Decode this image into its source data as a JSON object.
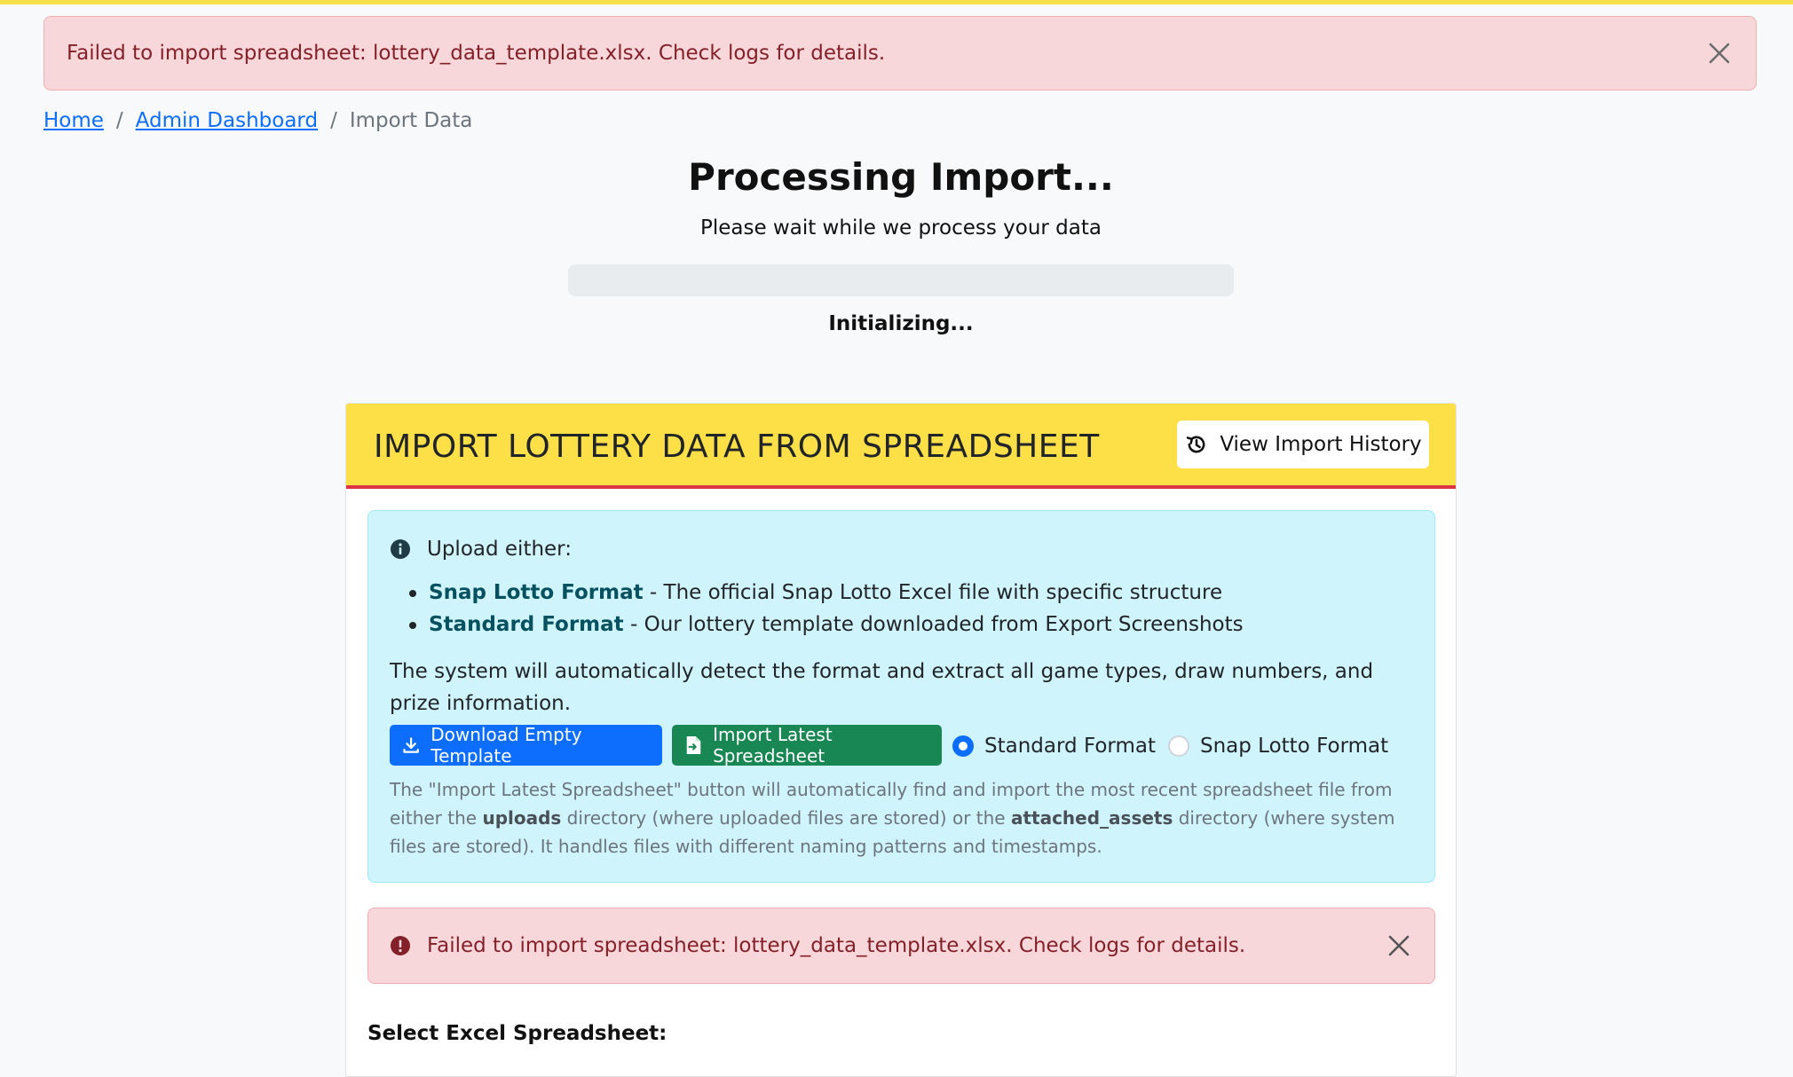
{
  "alert_top": {
    "message": "Failed to import spreadsheet: lottery_data_template.xlsx. Check logs for details."
  },
  "breadcrumb": {
    "home": "Home",
    "admin": "Admin Dashboard",
    "current": "Import Data",
    "separator": "/"
  },
  "processing": {
    "title": "Processing Import...",
    "subtitle": "Please wait while we process your data",
    "status": "Initializing...",
    "progress": 0
  },
  "card": {
    "title": "IMPORT LOTTERY DATA FROM SPREADSHEET",
    "history_button": "View Import History",
    "info": {
      "heading": "Upload either:",
      "items": [
        {
          "bold": "Snap Lotto Format",
          "text": " - The official Snap Lotto Excel file with specific structure"
        },
        {
          "bold": "Standard Format",
          "text": " - Our lottery template downloaded from Export Screenshots"
        }
      ],
      "description": "The system will automatically detect the format and extract all game types, draw numbers, and prize information.",
      "download_button": "Download Empty Template",
      "import_button": "Import Latest Spreadsheet",
      "radio_standard": "Standard Format",
      "radio_snap": "Snap Lotto Format",
      "selected_format": "Standard Format",
      "note_1": "The \"Import Latest Spreadsheet\" button will automatically find and import the most recent spreadsheet file from either the ",
      "note_bold_1": "uploads",
      "note_2": " directory (where uploaded files are stored) or the ",
      "note_bold_2": "attached_assets",
      "note_3": " directory (where system files are stored). It handles files with different naming patterns and timestamps."
    },
    "alert_inner": {
      "message": "Failed to import spreadsheet: lottery_data_template.xlsx. Check logs for details."
    },
    "select_label": "Select Excel Spreadsheet:"
  },
  "colors": {
    "accent_yellow": "#fde047",
    "danger": "#dc3545",
    "primary": "#0d6efd",
    "success": "#198754",
    "info_bg": "#cff4fc",
    "alert_bg": "#f8d7da"
  }
}
